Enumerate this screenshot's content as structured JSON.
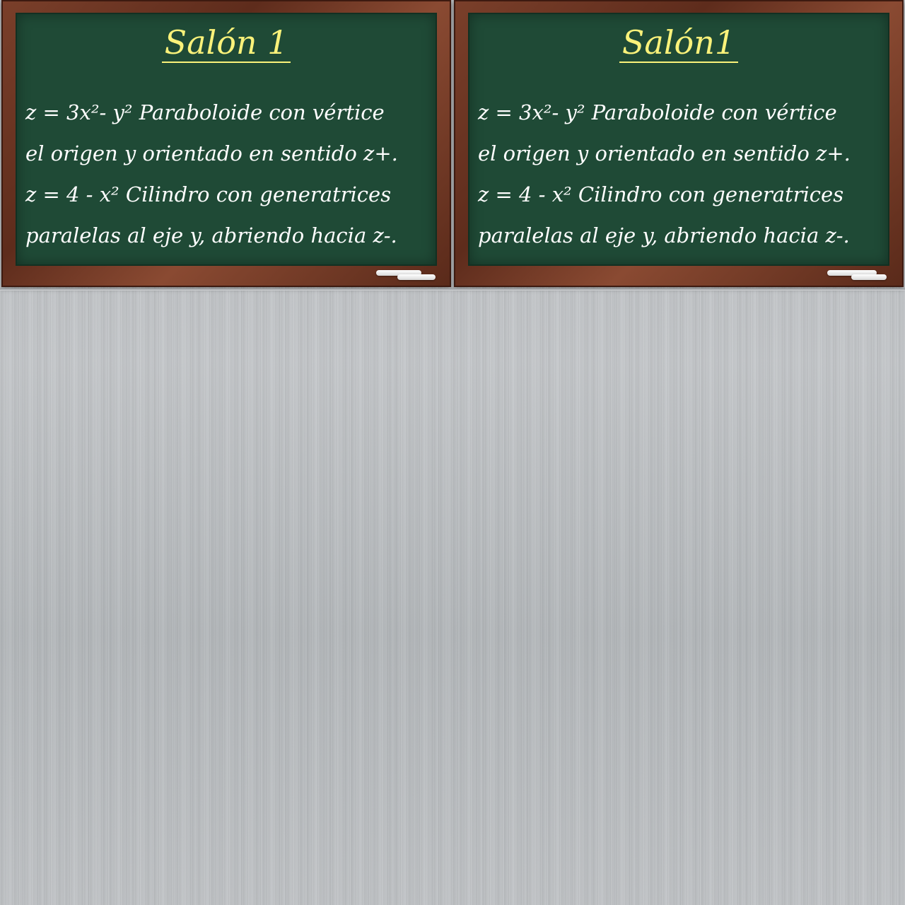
{
  "boards": [
    {
      "title": "Salón 1",
      "lines": [
        "z = 3x²- y²  Paraboloide con vértice",
        "el origen y orientado en sentido z+.",
        "z = 4 - x²  Cilindro con generatrices",
        "paralelas al eje y, abriendo hacia z-."
      ]
    },
    {
      "title": "Salón1",
      "lines": [
        "z = 3x²- y²  Paraboloide con vértice",
        "el origen y orientado en sentido z+.",
        "z = 4 - x²  Cilindro con generatrices",
        "paralelas al eje y, abriendo hacia z-."
      ]
    }
  ],
  "colors": {
    "chalkboard": "#1f4a36",
    "frame": "#6b3422",
    "title": "#fbf27a",
    "text": "#ffffff",
    "background": "#bdc0c3"
  }
}
